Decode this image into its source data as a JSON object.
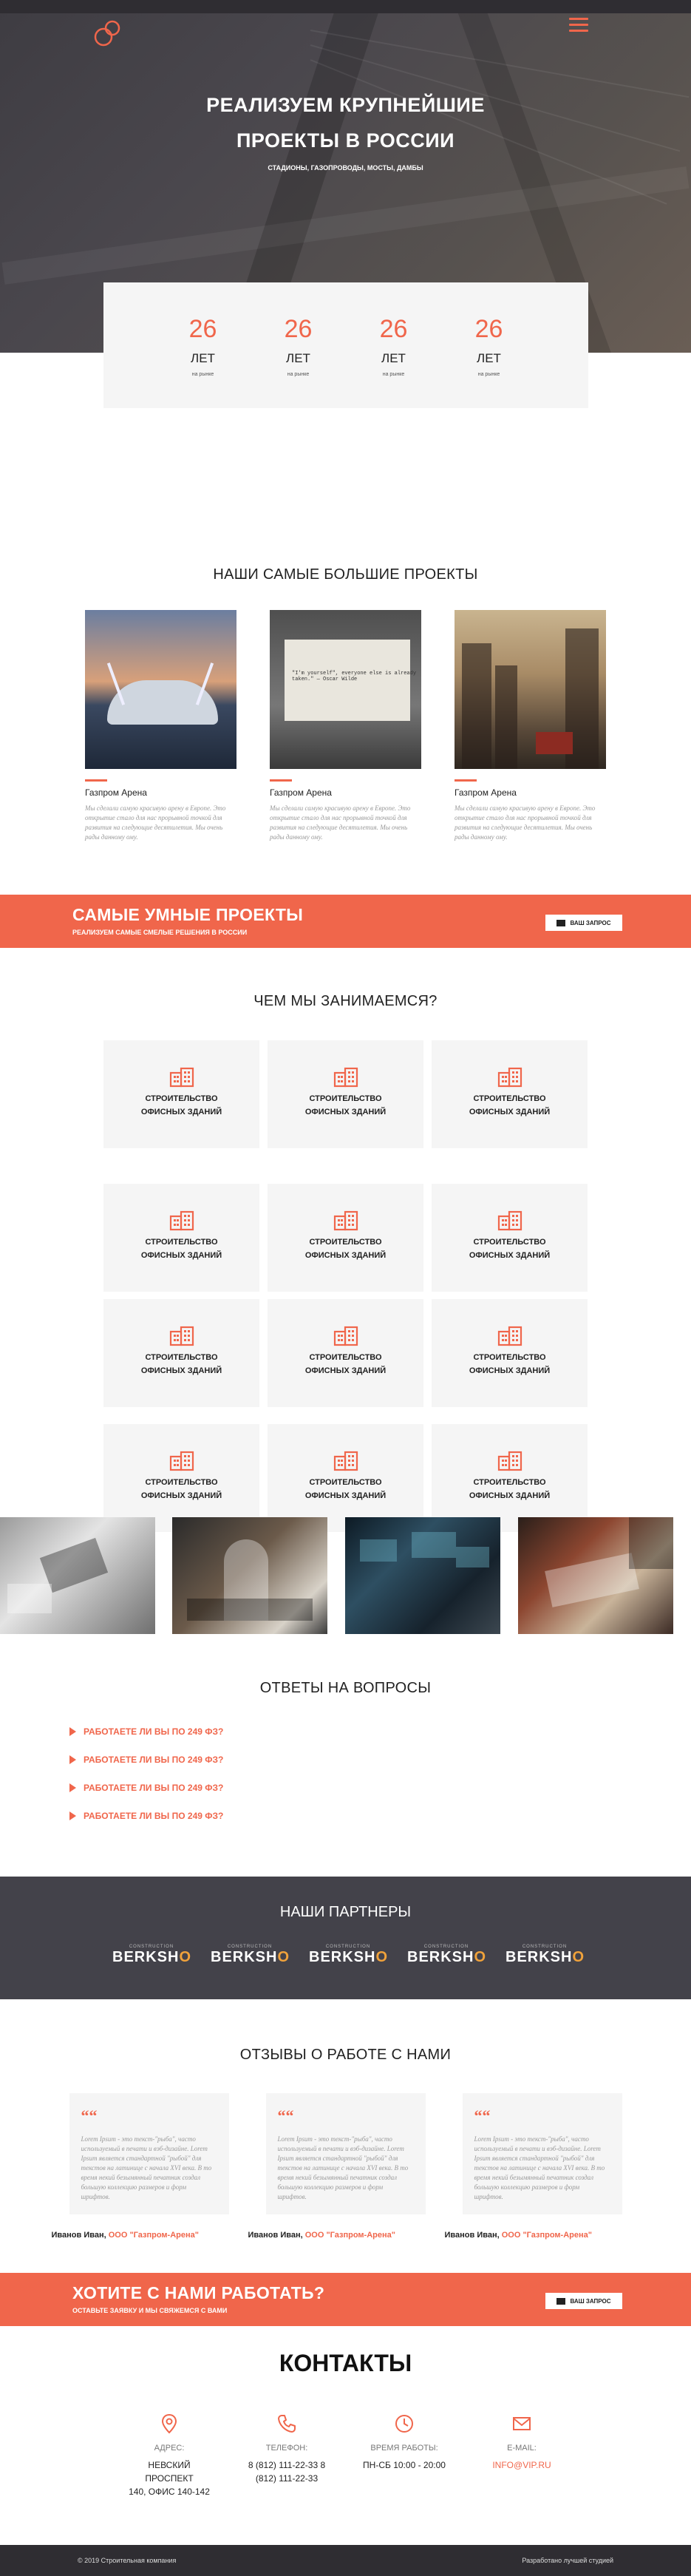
{
  "hero": {
    "title_line1": "РЕАЛИЗУЕМ КРУПНЕЙШИЕ",
    "title_line2": "ПРОЕКТЫ В РОССИИ",
    "subtitle": "СТАДИОНЫ, ГАЗОПРОВОДЫ, МОСТЫ, ДАМБЫ"
  },
  "stats": [
    {
      "number": "26",
      "label": "ЛЕТ",
      "sub": "на рынке"
    },
    {
      "number": "26",
      "label": "ЛЕТ",
      "sub": "на рынке"
    },
    {
      "number": "26",
      "label": "ЛЕТ",
      "sub": "на рынке"
    },
    {
      "number": "26",
      "label": "ЛЕТ",
      "sub": "на рынке"
    }
  ],
  "projects": {
    "title": "НАШИ САМЫЕ БОЛЬШИЕ ПРОЕКТЫ",
    "items": [
      {
        "name": "Газпром Арена",
        "desc": "Мы сделали самую красивую арену в Европе. Это открытие стало для нас прорывной точкой для развития на следующие десятилетия. Мы очень рады данному ому."
      },
      {
        "name": "Газпром Арена",
        "desc": "Мы сделали самую красивую арену в Европе. Это открытие стало для нас прорывной точкой для развития на следующие десятилетия. Мы очень рады данному ому."
      },
      {
        "name": "Газпром Арена",
        "desc": "Мы сделали самую красивую арену в Европе. Это открытие стало для нас прорывной точкой для развития на следующие десятилетия. Мы очень рады данному ому."
      }
    ],
    "typewriter_text": "\"I'm yourself\", everyone else is already taken.\" — Oscar Wilde"
  },
  "banner1": {
    "title": "САМЫЕ УМНЫЕ ПРОЕКТЫ",
    "subtitle": "РЕАЛИЗУЕМ САМЫЕ СМЕЛЫЕ РЕШЕНИЯ В РОССИИ",
    "button": "ВАШ ЗАПРОС"
  },
  "services": {
    "title": "ЧЕМ МЫ ЗАНИМАЕМСЯ?",
    "items": [
      {
        "line1": "СТРОИТЕЛЬСТВО",
        "line2": "ОФИСНЫХ ЗДАНИЙ"
      },
      {
        "line1": "СТРОИТЕЛЬСТВО",
        "line2": "ОФИСНЫХ ЗДАНИЙ"
      },
      {
        "line1": "СТРОИТЕЛЬСТВО",
        "line2": "ОФИСНЫХ ЗДАНИЙ"
      },
      {
        "line1": "СТРОИТЕЛЬСТВО",
        "line2": "ОФИСНЫХ ЗДАНИЙ"
      },
      {
        "line1": "СТРОИТЕЛЬСТВО",
        "line2": "ОФИСНЫХ ЗДАНИЙ"
      },
      {
        "line1": "СТРОИТЕЛЬСТВО",
        "line2": "ОФИСНЫХ ЗДАНИЙ"
      },
      {
        "line1": "СТРОИТЕЛЬСТВО",
        "line2": "ОФИСНЫХ ЗДАНИЙ"
      },
      {
        "line1": "СТРОИТЕЛЬСТВО",
        "line2": "ОФИСНЫХ ЗДАНИЙ"
      },
      {
        "line1": "СТРОИТЕЛЬСТВО",
        "line2": "ОФИСНЫХ ЗДАНИЙ"
      },
      {
        "line1": "СТРОИТЕЛЬСТВО",
        "line2": "ОФИСНЫХ ЗДАНИЙ"
      },
      {
        "line1": "СТРОИТЕЛЬСТВО",
        "line2": "ОФИСНЫХ ЗДАНИЙ"
      },
      {
        "line1": "СТРОИТЕЛЬСТВО",
        "line2": "ОФИСНЫХ ЗДАНИЙ"
      }
    ]
  },
  "faq": {
    "title": "ОТВЕТЫ НА ВОПРОСЫ",
    "items": [
      "РАБОТАЕТЕ ЛИ ВЫ ПО 249 ФЗ?",
      "РАБОТАЕТЕ ЛИ ВЫ ПО 249 ФЗ?",
      "РАБОТАЕТЕ ЛИ ВЫ ПО 249 ФЗ?",
      "РАБОТАЕТЕ ЛИ ВЫ ПО 249 ФЗ?"
    ]
  },
  "partners": {
    "title": "НАШИ ПАРТНЕРЫ",
    "logos": [
      {
        "small": "CONSTRUCTION",
        "name": "BERKSH",
        "suffix": "O"
      },
      {
        "small": "CONSTRUCTION",
        "name": "BERKSH",
        "suffix": "O"
      },
      {
        "small": "CONSTRUCTION",
        "name": "BERKSH",
        "suffix": "O"
      },
      {
        "small": "CONSTRUCTION",
        "name": "BERKSH",
        "suffix": "O"
      },
      {
        "small": "CONSTRUCTION",
        "name": "BERKSH",
        "suffix": "O"
      }
    ]
  },
  "reviews": {
    "title": "ОТЗЫВЫ О РАБОТЕ С НАМИ",
    "items": [
      {
        "text": "Lorem Ipsum - это текст-\"рыба\", часто используемый в печати и вэб-дизайне. Lorem Ipsum является стандартной \"рыбой\" для текстов на латинице с начала XVI века. В то время некий безымянный печатник создал большую коллекцию размеров и форм шрифтов.",
        "author": "Иванов Иван,",
        "company": "ООО \"Газпром-Арена\""
      },
      {
        "text": "Lorem Ipsum - это текст-\"рыба\", часто используемый в печати и вэб-дизайне. Lorem Ipsum является стандартной \"рыбой\" для текстов на латинице с начала XVI века. В то время некий безымянный печатник создал большую коллекцию размеров и форм шрифтов.",
        "author": "Иванов Иван,",
        "company": "ООО \"Газпром-Арена\""
      },
      {
        "text": "Lorem Ipsum - это текст-\"рыба\", часто используемый в печати и вэб-дизайне. Lorem Ipsum является стандартной \"рыбой\" для текстов на латинице с начала XVI века. В то время некий безымянный печатник создал большую коллекцию размеров и форм шрифтов.",
        "author": "Иванов Иван,",
        "company": "ООО \"Газпром-Арена\""
      }
    ]
  },
  "banner2": {
    "title": "ХОТИТЕ С НАМИ РАБОТАТЬ?",
    "subtitle": "ОСТАВЬТЕ ЗАЯВКУ И МЫ СВЯЖЕМСЯ С ВАМИ",
    "button": "ВАШ ЗАПРОС"
  },
  "contacts": {
    "title": "КОНТАКТЫ",
    "address": {
      "label": "АДРЕС:",
      "line1": "НЕВСКИЙ ПРОСПЕКТ",
      "line2": "140, ОФИС 140-142"
    },
    "phone": {
      "label": "ТЕЛЕФОН:",
      "line1": "8 (812) 111-22-33 8",
      "line2": "(812) 111-22-33"
    },
    "hours": {
      "label": "ВРЕМЯ РАБОТЫ:",
      "line1": "ПН-СБ 10:00 - 20:00"
    },
    "email": {
      "label": "E-MAIL:",
      "line1": "INFO@VIP.RU"
    }
  },
  "footer": {
    "copyright": "© 2019 Строительная компания",
    "developer": "Разработано лучшей студией"
  },
  "colors": {
    "accent": "#f0664b",
    "dark": "#43424a",
    "light_bg": "#f5f5f5"
  }
}
